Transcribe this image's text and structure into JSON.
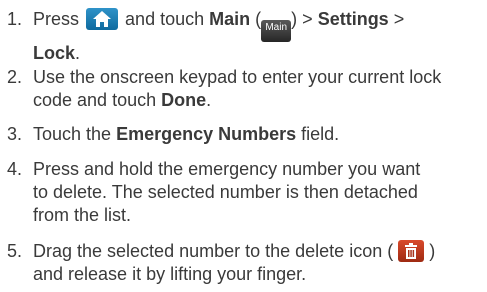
{
  "steps": [
    {
      "num": "1.",
      "line1_a": "Press",
      "line1_b": "and touch",
      "main_label": "Main",
      "paren_open": "(",
      "main_icon_text": "Main",
      "paren_close": ")",
      "gt1": " > ",
      "settings_label": "Settings",
      "gt2": " >",
      "lock_label": "Lock",
      "period": "."
    },
    {
      "num": "2.",
      "line1": "Use the onscreen keypad to enter your current lock",
      "line2_a": "code and touch ",
      "done_label": "Done",
      "period": "."
    },
    {
      "num": "3.",
      "text_a": "Touch the ",
      "field_label": "Emergency Numbers",
      "text_b": " field."
    },
    {
      "num": "4.",
      "line1": "Press and hold the emergency number you want",
      "line2": "to delete. The selected number is then detached",
      "line3": "from the list."
    },
    {
      "num": "5.",
      "line1_a": "Drag the selected number to the delete icon (",
      "line1_b": ")",
      "line2": "and release it by lifting your finger."
    }
  ],
  "icons": {
    "home": "home-icon",
    "main": "main-menu-icon",
    "trash": "trash-icon"
  },
  "colors": {
    "text": "#3a3a3a",
    "home_button": "#1a7db5",
    "main_icon": "#3a3a3a",
    "trash_button": "#c23a1c"
  }
}
